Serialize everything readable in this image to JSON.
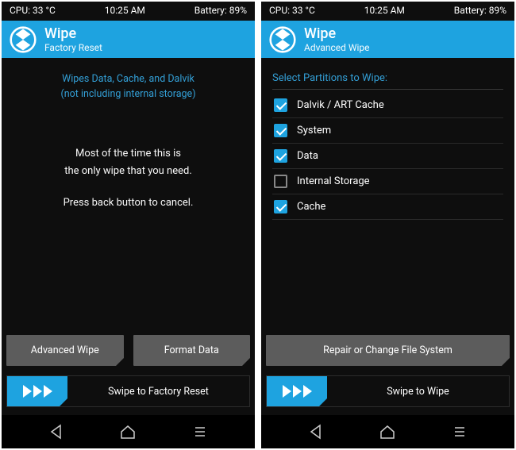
{
  "left": {
    "status": {
      "cpu": "CPU: 33 °C",
      "time": "10:25 AM",
      "battery": "Battery: 89%"
    },
    "header": {
      "title": "Wipe",
      "subtitle": "Factory Reset"
    },
    "help_line1": "Wipes Data, Cache, and Dalvik",
    "help_line2": "(not including internal storage)",
    "mid_line1": "Most of the time this is",
    "mid_line2": "the only wipe that you need.",
    "mid_line3": "Press back button to cancel.",
    "btn_advanced": "Advanced Wipe",
    "btn_format": "Format Data",
    "swipe_label": "Swipe to Factory Reset"
  },
  "right": {
    "status": {
      "cpu": "CPU: 33 °C",
      "time": "10:25 AM",
      "battery": "Battery: 89%"
    },
    "header": {
      "title": "Wipe",
      "subtitle": "Advanced Wipe"
    },
    "section": "Select Partitions to Wipe:",
    "items": [
      {
        "label": "Dalvik / ART Cache",
        "checked": true
      },
      {
        "label": "System",
        "checked": true
      },
      {
        "label": "Data",
        "checked": true
      },
      {
        "label": "Internal Storage",
        "checked": false
      },
      {
        "label": "Cache",
        "checked": true
      }
    ],
    "btn_repair": "Repair or Change File System",
    "swipe_label": "Swipe to Wipe"
  }
}
